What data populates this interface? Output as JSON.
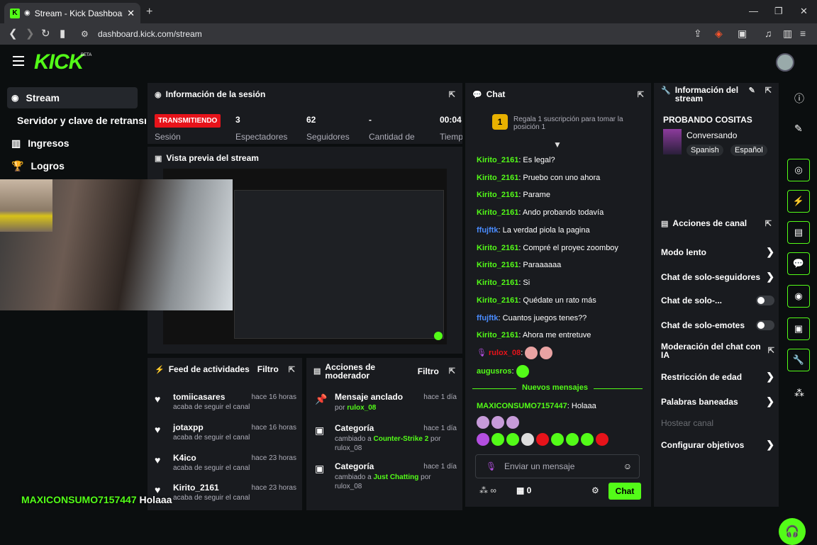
{
  "browser": {
    "tab_title": "Stream - Kick Dashboard",
    "url": "dashboard.kick.com/stream"
  },
  "brand": {
    "logo": "KICK",
    "beta": "BETA",
    "accent": "#53fc18"
  },
  "nav": {
    "items": [
      {
        "label": "Stream"
      },
      {
        "label": "Servidor y clave de retransmisión"
      },
      {
        "label": "Ingresos"
      },
      {
        "label": "Logros"
      }
    ]
  },
  "session": {
    "title": "Información de la sesión",
    "status": "TRANSMITIENDO",
    "stats": [
      {
        "value": "3",
        "label": "Espectadores"
      },
      {
        "value": "62",
        "label": "Seguidores"
      },
      {
        "value": "-",
        "label": "Cantidad de"
      },
      {
        "value": "00:04",
        "label": "Tiemp"
      }
    ],
    "session_label": "Sesión"
  },
  "preview": {
    "title": "Vista previa del stream"
  },
  "activity": {
    "title": "Feed de actividades",
    "filter": "Filtro",
    "items": [
      {
        "name": "tomiicasares",
        "time": "hace 16 horas",
        "sub": "acaba de seguir el canal"
      },
      {
        "name": "jotaxpp",
        "time": "hace 16 horas",
        "sub": "acaba de seguir el canal"
      },
      {
        "name": "K4ico",
        "time": "hace 23 horas",
        "sub": "acaba de seguir el canal"
      },
      {
        "name": "Kirito_2161",
        "time": "hace 23 horas",
        "sub": "acaba de seguir el canal"
      }
    ]
  },
  "mod": {
    "title": "Acciones de moderador",
    "filter": "Filtro",
    "items": [
      {
        "name": "Mensaje anclado",
        "time": "hace 1 día",
        "pre": "por ",
        "link": "rulox_08",
        "post": ""
      },
      {
        "name": "Categoría",
        "time": "hace 1 día",
        "pre": "cambiado a ",
        "link": "Counter-Strike 2",
        "post": " por rulox_08"
      },
      {
        "name": "Categoría",
        "time": "hace 1 día",
        "pre": "cambiado a ",
        "link": "Just Chatting",
        "post": " por rulox_08"
      }
    ]
  },
  "chat": {
    "title": "Chat",
    "sub_gift": "Regala 1 suscripción para tomar la posición 1",
    "sub_rank": "1",
    "messages": [
      {
        "user": "Kirito_2161",
        "text": ": Es legal?",
        "color": "u1"
      },
      {
        "user": "Kirito_2161",
        "text": ": Pruebo con uno ahora",
        "color": "u1"
      },
      {
        "user": "Kirito_2161",
        "text": ": Parame",
        "color": "u1"
      },
      {
        "user": "Kirito_2161",
        "text": ": Ando probando todavía",
        "color": "u1"
      },
      {
        "user": "ffujftk",
        "text": ": La verdad piola la pagina",
        "color": "u2"
      },
      {
        "user": "Kirito_2161",
        "text": ": Compré el proyec zoomboy",
        "color": "u1"
      },
      {
        "user": "Kirito_2161",
        "text": ": Paraaaaaa",
        "color": "u1"
      },
      {
        "user": "Kirito_2161",
        "text": ": Si",
        "color": "u1"
      },
      {
        "user": "Kirito_2161",
        "text": ": Quédate un rato más",
        "color": "u1"
      },
      {
        "user": "ffujftk",
        "text": ": Cuantos juegos tenes??",
        "color": "u2"
      },
      {
        "user": "Kirito_2161",
        "text": ": Ahora me entretuve",
        "color": "u1"
      },
      {
        "user": "rulox_08",
        "text": ":",
        "color": "u3"
      },
      {
        "user": "augusros",
        "text": ":",
        "color": "u1"
      }
    ],
    "new_messages": "Nuevos mensajes",
    "last_user": "MAXICONSUMO7157447",
    "last_text": ": Holaaa",
    "input_placeholder": "Enviar un mensaje",
    "viewer_count": "0",
    "send": "Chat"
  },
  "stream_info": {
    "title": "Información del stream",
    "stream_title": "PROBANDO COSITAS",
    "category": "Conversando",
    "tags": [
      "Spanish",
      "Español"
    ]
  },
  "channel_actions": {
    "title": "Acciones de canal",
    "items": [
      {
        "label": "Modo lento",
        "kind": "chevron"
      },
      {
        "label": "Chat de solo-seguidores",
        "kind": "chevron"
      },
      {
        "label": "Chat de solo-...",
        "kind": "toggle"
      },
      {
        "label": "Chat de solo-emotes",
        "kind": "toggle"
      },
      {
        "label": "Moderación del chat con IA",
        "kind": "external"
      },
      {
        "label": "Restricción de edad",
        "kind": "chevron"
      },
      {
        "label": "Palabras baneadas",
        "kind": "chevron"
      },
      {
        "label": "Hostear canal",
        "kind": "disabled"
      },
      {
        "label": "Configurar objetivos",
        "kind": "chevron"
      }
    ]
  },
  "overlay": {
    "user": "MAXICONSUMO7157447",
    "text": "Holaaa"
  }
}
